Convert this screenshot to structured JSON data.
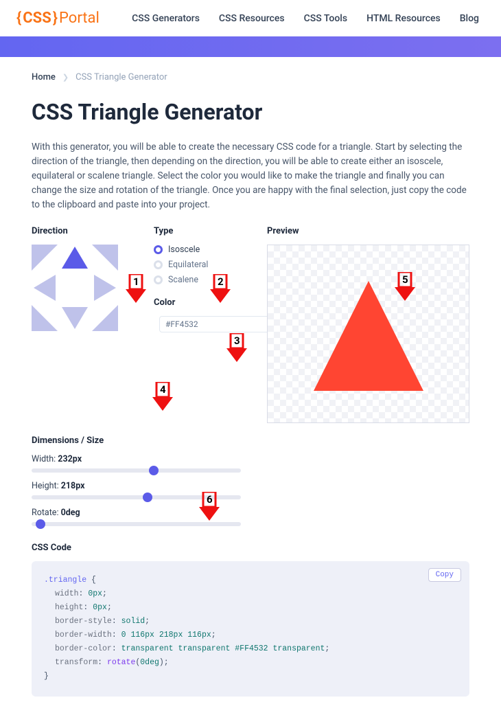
{
  "header": {
    "logo_brace_open": "{",
    "logo_css": "CSS",
    "logo_brace_close": "}",
    "logo_portal": "Portal",
    "nav": [
      "CSS Generators",
      "CSS Resources",
      "CSS Tools",
      "HTML Resources",
      "Blog"
    ]
  },
  "breadcrumb": {
    "home": "Home",
    "current": "CSS Triangle Generator"
  },
  "page": {
    "title": "CSS Triangle Generator",
    "intro": "With this generator, you will be able to create the necessary CSS code for a triangle. Start by selecting the direction of the triangle, then depending on the direction, you will be able to create either an isoscele, equilateral or scalene triangle. Select the color you would like to make the triangle and finally you can change the size and rotation of the triangle. Once you are happy with the final selection, just copy the code to the clipboard and paste into your project."
  },
  "direction": {
    "label": "Direction"
  },
  "type": {
    "label": "Type",
    "options": [
      "Isoscele",
      "Equilateral",
      "Scalene"
    ],
    "selected": "Isoscele"
  },
  "color": {
    "label": "Color",
    "value": "#FF4532"
  },
  "preview": {
    "label": "Preview"
  },
  "dimensions": {
    "label": "Dimensions / Size",
    "width_label": "Width: ",
    "width_value": "232px",
    "width_pct": 56,
    "height_label": "Height: ",
    "height_value": "218px",
    "height_pct": 53,
    "rotate_label": "Rotate: ",
    "rotate_value": "0deg",
    "rotate_pct": 2
  },
  "code": {
    "label": "CSS Code",
    "copy": "Copy",
    "selector": ".triangle",
    "lines": {
      "width_prop": "width",
      "width_val": "0px",
      "height_prop": "height",
      "height_val": "0px",
      "bstyle_prop": "border-style",
      "bstyle_val": "solid",
      "bwidth_prop": "border-width",
      "bwidth_val": "0 116px 218px 116px",
      "bcolor_prop": "border-color",
      "bcolor_val": "transparent transparent #FF4532 transparent",
      "trans_prop": "transform",
      "trans_fn": "rotate",
      "trans_arg": "0deg"
    }
  },
  "annotations": {
    "a1": "1",
    "a2": "2",
    "a3": "3",
    "a4": "4",
    "a5": "5",
    "a6": "6"
  }
}
